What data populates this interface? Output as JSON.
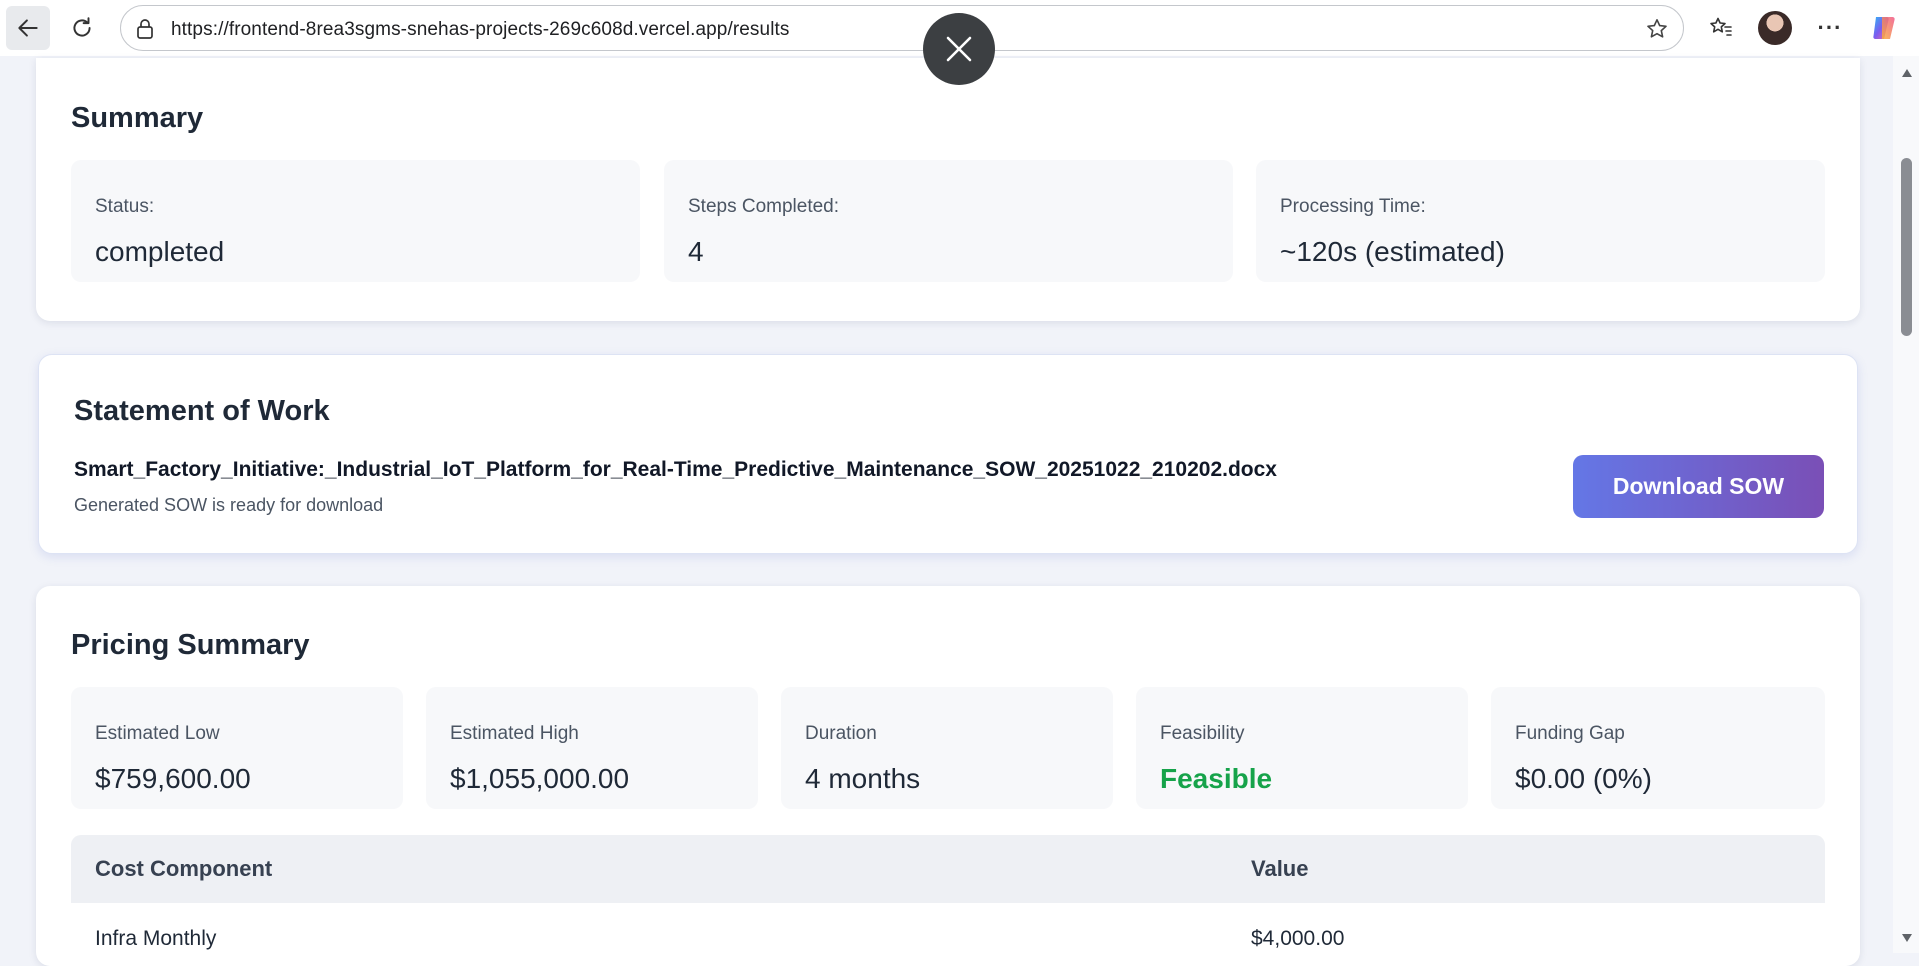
{
  "browser": {
    "url": "https://frontend-8rea3sgms-snehas-projects-269c608d.vercel.app/results"
  },
  "summary": {
    "title": "Summary",
    "stats": [
      {
        "label": "Status:",
        "value": "completed"
      },
      {
        "label": "Steps Completed:",
        "value": "4"
      },
      {
        "label": "Processing Time:",
        "value": "~120s (estimated)"
      }
    ]
  },
  "sow": {
    "title": "Statement of Work",
    "filename": "Smart_Factory_Initiative:_Industrial_IoT_Platform_for_Real-Time_Predictive_Maintenance_SOW_20251022_210202.docx",
    "subtitle": "Generated SOW is ready for download",
    "download_label": "Download SOW"
  },
  "pricing": {
    "title": "Pricing Summary",
    "stats": [
      {
        "label": "Estimated Low",
        "value": "$759,600.00"
      },
      {
        "label": "Estimated High",
        "value": "$1,055,000.00"
      },
      {
        "label": "Duration",
        "value": "4 months"
      },
      {
        "label": "Feasibility",
        "value": "Feasible"
      },
      {
        "label": "Funding Gap",
        "value": "$0.00 (0%)"
      }
    ],
    "table": {
      "headers": [
        "Cost Component",
        "Value"
      ],
      "rows": [
        [
          "Infra Monthly",
          "$4,000.00"
        ]
      ]
    }
  },
  "colors": {
    "accent_gradient_start": "#6477e6",
    "accent_gradient_end": "#7a4fb6",
    "feasible_green": "#16a34a"
  }
}
